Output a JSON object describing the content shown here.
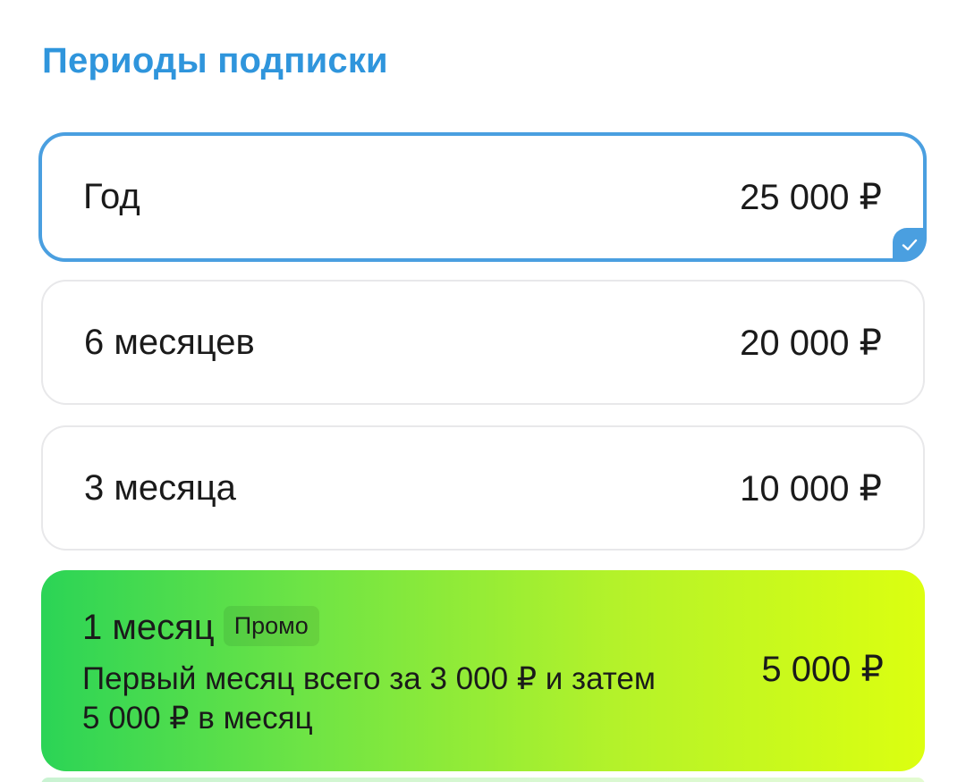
{
  "section": {
    "title": "Периоды подписки"
  },
  "plans": [
    {
      "name": "Год",
      "price": "25 000 ₽",
      "selected": true
    },
    {
      "name": "6 месяцев",
      "price": "20 000 ₽",
      "selected": false
    },
    {
      "name": "3 месяца",
      "price": "10 000 ₽",
      "selected": false
    },
    {
      "name": "1 месяц",
      "badge": "Промо",
      "description": "Первый месяц всего за 3 000 ₽ и затем 5 000 ₽ в месяц",
      "price": "5 000 ₽",
      "selected": false
    }
  ],
  "colors": {
    "accent": "#4a9fe0",
    "title": "#2f95dc",
    "promo_gradient_start": "#2bd456",
    "promo_gradient_end": "#dcff10",
    "card_border": "#e8e8ea"
  },
  "icons": {
    "selected_indicator": "check-icon"
  }
}
